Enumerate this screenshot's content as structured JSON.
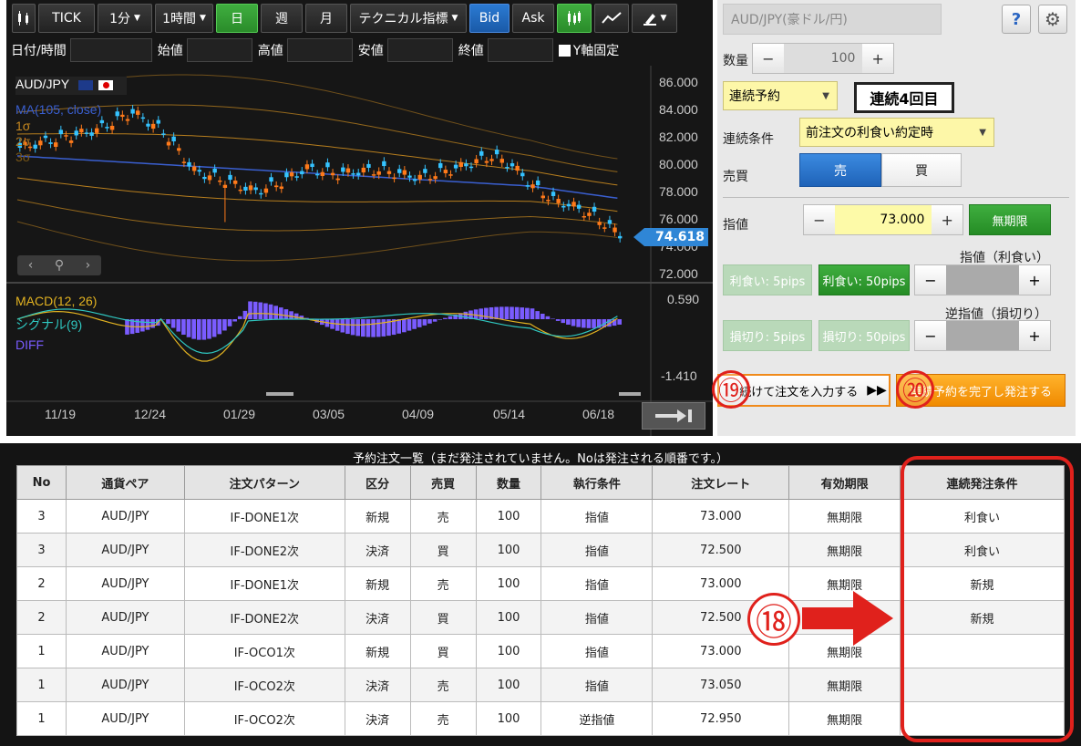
{
  "toolbar": {
    "tick": "TICK",
    "interval1": "1分",
    "interval2": "1時間",
    "day": "日",
    "week": "週",
    "month": "月",
    "indicators": "テクニカル指標",
    "bid": "Bid",
    "ask": "Ask"
  },
  "ohlc": {
    "datetime": "日付/時間",
    "open": "始値",
    "high": "高値",
    "low": "安値",
    "close": "終値",
    "yaxis_fixed": "Y軸固定"
  },
  "chart": {
    "symbol": "AUD/JPY",
    "ma_label": "MA(105, close)",
    "sigma1": "1σ",
    "sigma2": "2σ",
    "sigma3": "3σ",
    "price_ticks": [
      "86.000",
      "84.000",
      "82.000",
      "80.000",
      "78.000",
      "76.000",
      "74.000",
      "72.000"
    ],
    "current_price": "74.618",
    "macd_label": "MACD(12, 26)",
    "signal_label": "シグナル(9)",
    "diff_label": "DIFF",
    "macd_max": "0.590",
    "macd_min": "-1.410",
    "dates": [
      "11/19",
      "12/24",
      "01/29",
      "03/05",
      "04/09",
      "05/14",
      "06/18"
    ],
    "colors": {
      "ma": "#3a5fd0",
      "bands": "#c98a1f",
      "up": "#ff7a1a",
      "down": "#35c3ff",
      "macd": "#e3b321",
      "signal": "#2fc7c0",
      "diff": "#7a5cff"
    }
  },
  "order": {
    "symbol": "AUD/JPY(豪ドル/円)",
    "help": "?",
    "qty_label": "数量",
    "qty_value": "100",
    "minus": "−",
    "plus": "+",
    "order_type": "連続予約",
    "renzoku_count": "連続4回目",
    "cond_label": "連続条件",
    "cond_value": "前注文の利食い約定時",
    "side_label": "売買",
    "sell": "売",
    "buy": "買",
    "price_label": "指値",
    "price_value": "73.000",
    "expiry": "無期限",
    "tp_label": "指値（利食い）",
    "tp5": "利食い: 5pips",
    "tp50": "利食い: 50pips",
    "sl_label": "逆指値（損切り）",
    "sl5": "損切り: 5pips",
    "sl50": "損切り: 50pips",
    "continue_btn": "続けて注文を入力する",
    "finish_btn": "連続予約を完了し発注する",
    "marker19": "⑲",
    "marker20": "⑳"
  },
  "list": {
    "title": "予約注文一覧（まだ発注されていません。Noは発注される順番です。）",
    "headers": [
      "No",
      "通貨ペア",
      "注文パターン",
      "区分",
      "売買",
      "数量",
      "執行条件",
      "注文レート",
      "有効期限",
      "連続発注条件"
    ],
    "rows": [
      [
        "3",
        "AUD/JPY",
        "IF-DONE1次",
        "新規",
        "売",
        "100",
        "指値",
        "73.000",
        "無期限",
        "利食い"
      ],
      [
        "3",
        "AUD/JPY",
        "IF-DONE2次",
        "決済",
        "買",
        "100",
        "指値",
        "72.500",
        "無期限",
        "利食い"
      ],
      [
        "2",
        "AUD/JPY",
        "IF-DONE1次",
        "新規",
        "売",
        "100",
        "指値",
        "73.000",
        "無期限",
        "新規"
      ],
      [
        "2",
        "AUD/JPY",
        "IF-DONE2次",
        "決済",
        "買",
        "100",
        "指値",
        "72.500",
        "無期限",
        "新規"
      ],
      [
        "1",
        "AUD/JPY",
        "IF-OCO1次",
        "新規",
        "買",
        "100",
        "指値",
        "73.000",
        "無期限",
        ""
      ],
      [
        "1",
        "AUD/JPY",
        "IF-OCO2次",
        "決済",
        "売",
        "100",
        "指値",
        "73.050",
        "無期限",
        ""
      ],
      [
        "1",
        "AUD/JPY",
        "IF-OCO2次",
        "決済",
        "売",
        "100",
        "逆指値",
        "72.950",
        "無期限",
        ""
      ]
    ],
    "marker18": "⑱"
  }
}
